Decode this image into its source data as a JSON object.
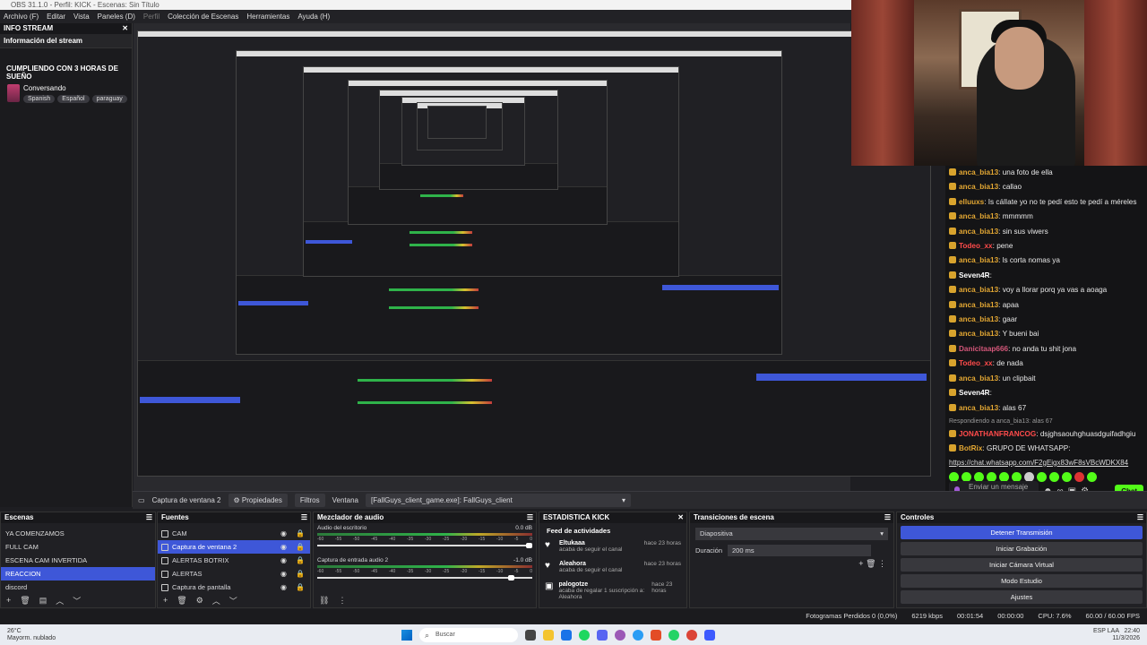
{
  "window": {
    "title": "OBS 31.1.0 - Perfil: KICK - Escenas: Sin Título"
  },
  "menu": [
    "Archivo (F)",
    "Editar",
    "Vista",
    "Paneles (D)",
    "Perfil",
    "Colección de Escenas",
    "Herramientas",
    "Ayuda (H)"
  ],
  "info_dock": {
    "header": "INFO STREAM",
    "subheader": "Información del stream",
    "stream_title": "CUMPLIENDO CON 3 HORAS DE SUEÑO",
    "category": "Conversando",
    "tags": [
      "Spanish",
      "Español",
      "paraguay"
    ]
  },
  "chat": {
    "messages": [
      {
        "user": "anca_bia13",
        "text": "una foto de ella",
        "color": "#e3a733"
      },
      {
        "user": "anca_bia13",
        "text": "callao",
        "color": "#e3a733"
      },
      {
        "user": "elluuxs",
        "text": "Is cálIate yo no te pedí esto te pedí a méreles",
        "color": "#e3a733"
      },
      {
        "user": "anca_bia13",
        "text": "mmmmm",
        "color": "#e3a733"
      },
      {
        "user": "anca_bia13",
        "text": "sin sus viwers",
        "color": "#e3a733"
      },
      {
        "user": "Todeo_xx",
        "text": "pene",
        "color": "#ff4b4b"
      },
      {
        "user": "anca_bia13",
        "text": "ls corta nomas ya",
        "color": "#e3a733"
      },
      {
        "user": "Seven4R",
        "text": "",
        "color": "#ffffff"
      },
      {
        "user": "anca_bia13",
        "text": "voy a llorar porq ya vas a aoaga",
        "color": "#e3a733"
      },
      {
        "user": "anca_bia13",
        "text": "apaa",
        "color": "#e3a733"
      },
      {
        "user": "anca_bia13",
        "text": "gaar",
        "color": "#e3a733"
      },
      {
        "user": "anca_bia13",
        "text": "Y bueni bai",
        "color": "#e3a733"
      },
      {
        "user": "Danicitaap666",
        "text": "no anda tu shit jona",
        "color": "#d4577a"
      },
      {
        "user": "Todeo_xx",
        "text": "de nada",
        "color": "#ff4b4b"
      },
      {
        "user": "anca_bia13",
        "text": "un clipbait",
        "color": "#e3a733"
      },
      {
        "user": "Seven4R",
        "text": "",
        "color": "#ffffff"
      },
      {
        "user": "anca_bia13",
        "text": "alas 67",
        "color": "#e3a733"
      }
    ],
    "reply_to": "Respondiendo a anca_bia13: alas 67",
    "reply_msg": {
      "user": "JONATHANFRANCOG",
      "text": "dsjghsaouhghuasdguifadhgiu",
      "color": "#ff4b4b"
    },
    "bot_msg": {
      "user": "BotRix",
      "text": "GRUPO DE WHATSAPP:",
      "color": "#e3a733"
    },
    "link": "https://chat.whatsapp.com/F2gEigx83wF8sVBcWDKX84",
    "input_placeholder": "Enviar un mensaje",
    "send_label": "Chat"
  },
  "source_toolbar": {
    "source_name": "Captura de ventana 2",
    "properties": "Propiedades",
    "filters": "Filtros",
    "window_label": "Ventana",
    "window_value": "[FallGuys_client_game.exe]: FallGuys_client"
  },
  "scenes": {
    "header": "Escenas",
    "items": [
      "YA COMENZAMOS",
      "FULL CAM",
      "ESCENA CAM INVERTIDA",
      "REACCION",
      "discord"
    ],
    "selected": 3
  },
  "sources": {
    "header": "Fuentes",
    "items": [
      "CAM",
      "Captura de ventana 2",
      "ALERTAS BOTRIX",
      "ALERTAS",
      "Captura de pantalla"
    ],
    "selected": 1
  },
  "mixer": {
    "header": "Mezclador de audio",
    "channels": [
      {
        "name": "Audio del escritorio",
        "db": "0.0 dB"
      },
      {
        "name": "Captura de entrada audio 2",
        "db": "-1.0 dB"
      }
    ],
    "ticks": [
      "-60",
      "-55",
      "-50",
      "-45",
      "-40",
      "-35",
      "-30",
      "-25",
      "-20",
      "-15",
      "-10",
      "-5",
      "0"
    ]
  },
  "kick_stats": {
    "header": "ESTADISTICA KICK",
    "feed_title": "Feed de actividades",
    "events": [
      {
        "user": "Eltukaaa",
        "action": "acaba de seguir el canal",
        "time": "hace 23 horas"
      },
      {
        "user": "Aleahora",
        "action": "acaba de seguir el canal",
        "time": "hace 23 horas"
      },
      {
        "user": "palogotze",
        "action": "acaba de regalar 1 suscripción a: Aleahora",
        "time": "hace 23 horas"
      }
    ]
  },
  "transitions": {
    "header": "Transiciones de escena",
    "current": "Diapositiva",
    "duration_label": "Duración",
    "duration_value": "200 ms"
  },
  "controls": {
    "header": "Controles",
    "buttons": [
      "Detener Transmisión",
      "Iniciar Grabación",
      "Iniciar Cámara Virtual",
      "Modo Estudio",
      "Ajustes"
    ]
  },
  "status": {
    "frames_dropped": "Fotogramas Perdidos 0 (0,0%)",
    "bitrate": "6219 kbps",
    "stream_time": "00:01:54",
    "rec_time": "00:00:00",
    "cpu": "CPU: 7.6%",
    "fps": "60.00 / 60.00 FPS"
  },
  "taskbar": {
    "weather_temp": "26°C",
    "weather_text": "Mayorm. nublado",
    "search_placeholder": "Buscar",
    "time": "22:40",
    "date": "11/3/2026",
    "lang": "ESP LAA"
  }
}
